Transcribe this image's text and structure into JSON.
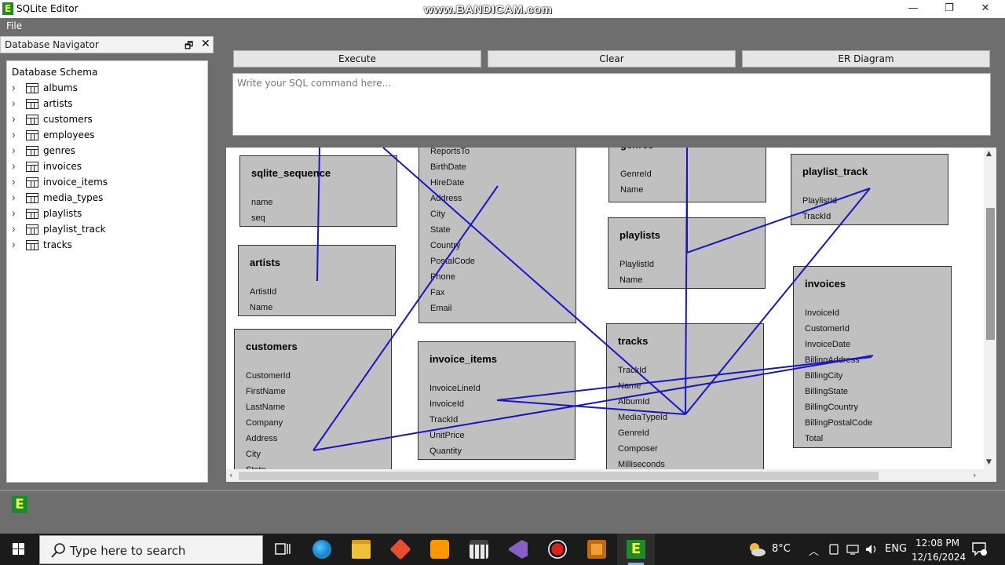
{
  "window": {
    "title": "SQLite Editor",
    "app_icon_letter": "E",
    "watermark": "www.BANDICAM.com",
    "minimize_glyph": "—",
    "restore_glyph": "❐",
    "close_glyph": "✕"
  },
  "menu": {
    "file": "File"
  },
  "navigator": {
    "title": "Database Navigator",
    "float_glyph": "🗗",
    "close_glyph": "✕",
    "root": "Database Schema",
    "chevron": "›",
    "tables": [
      "albums",
      "artists",
      "customers",
      "employees",
      "genres",
      "invoices",
      "invoice_items",
      "media_types",
      "playlists",
      "playlist_track",
      "tracks"
    ]
  },
  "toolbar": {
    "execute": "Execute",
    "clear": "Clear",
    "er_diagram": "ER Diagram"
  },
  "editor": {
    "placeholder": "Write your SQL command here...",
    "value": ""
  },
  "diagram": {
    "link_color": "#1616c8",
    "box_color": "#c0c0c0",
    "tables": {
      "sqlite_sequence": {
        "name": "sqlite_sequence",
        "columns": [
          "name",
          "seq"
        ]
      },
      "artists": {
        "name": "artists",
        "columns": [
          "ArtistId",
          "Name"
        ]
      },
      "customers": {
        "name": "customers",
        "columns": [
          "CustomerId",
          "FirstName",
          "LastName",
          "Company",
          "Address",
          "City",
          "State"
        ]
      },
      "employees": {
        "name": "",
        "columns": [
          "ReportsTo",
          "BirthDate",
          "HireDate",
          "Address",
          "City",
          "State",
          "Country",
          "PostalCode",
          "Phone",
          "Fax",
          "Email"
        ]
      },
      "invoice_items": {
        "name": "invoice_items",
        "columns": [
          "InvoiceLineId",
          "InvoiceId",
          "TrackId",
          "UnitPrice",
          "Quantity"
        ]
      },
      "genres": {
        "name": "genres",
        "columns": [
          "GenreId",
          "Name"
        ]
      },
      "playlists": {
        "name": "playlists",
        "columns": [
          "PlaylistId",
          "Name"
        ]
      },
      "tracks": {
        "name": "tracks",
        "columns": [
          "TrackId",
          "Name",
          "AlbumId",
          "MediaTypeId",
          "GenreId",
          "Composer",
          "Milliseconds"
        ]
      },
      "playlist_track": {
        "name": "playlist_track",
        "columns": [
          "PlaylistId",
          "TrackId"
        ]
      },
      "invoices": {
        "name": "invoices",
        "columns": [
          "InvoiceId",
          "CustomerId",
          "InvoiceDate",
          "BillingAddress",
          "BillingCity",
          "BillingState",
          "BillingCountry",
          "BillingPostalCode",
          "Total"
        ]
      }
    }
  },
  "scroll": {
    "up": "▲",
    "down": "▼",
    "left": "‹",
    "right": "›"
  },
  "dock": {
    "logo_letter": "E"
  },
  "taskbar": {
    "search_placeholder": "Type here to search",
    "temperature": "8°C",
    "language": "ENG",
    "time": "12:08 PM",
    "date": "12/16/2024",
    "tray_chevron": "︿"
  }
}
